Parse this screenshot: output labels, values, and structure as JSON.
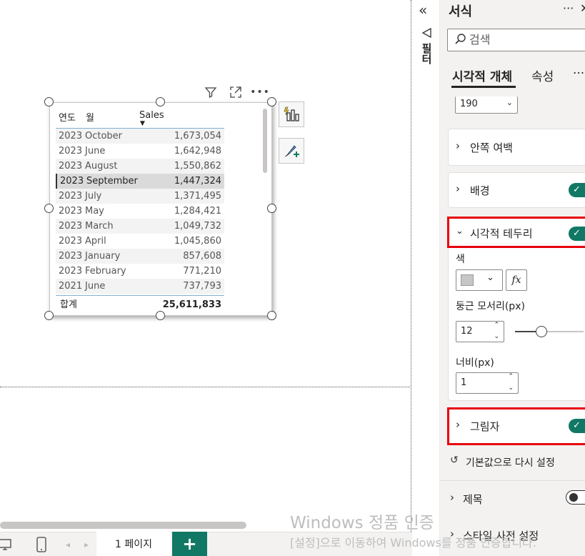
{
  "table": {
    "columns": [
      "연도",
      "월",
      "Sales"
    ],
    "rows": [
      {
        "year": "2023",
        "month": "October",
        "sales": "1,673,054"
      },
      {
        "year": "2023",
        "month": "June",
        "sales": "1,642,948"
      },
      {
        "year": "2023",
        "month": "August",
        "sales": "1,550,862"
      },
      {
        "year": "2023",
        "month": "September",
        "sales": "1,447,324"
      },
      {
        "year": "2023",
        "month": "July",
        "sales": "1,371,495"
      },
      {
        "year": "2023",
        "month": "May",
        "sales": "1,284,421"
      },
      {
        "year": "2023",
        "month": "March",
        "sales": "1,049,732"
      },
      {
        "year": "2023",
        "month": "April",
        "sales": "1,045,860"
      },
      {
        "year": "2023",
        "month": "January",
        "sales": "857,608"
      },
      {
        "year": "2023",
        "month": "February",
        "sales": "771,210"
      },
      {
        "year": "2021",
        "month": "June",
        "sales": "737,793"
      }
    ],
    "total_label": "합계",
    "total_value": "25,611,833",
    "sort_icon": "sort-descending-icon"
  },
  "visual_toolbar": [
    "filter-icon",
    "focus-mode-icon",
    "more-options-icon"
  ],
  "side_buttons": [
    "quick-insights-icon",
    "format-brush-icon"
  ],
  "filter_strip": {
    "label": "필터"
  },
  "pane": {
    "title": "서식",
    "more": "···",
    "close": "✕",
    "search_placeholder": "검색",
    "tabs": [
      "시각적 개체",
      "속성"
    ],
    "tabs_more": "···",
    "partial_value": "190",
    "sections": {
      "padding": "안쪽 여백",
      "background": "배경",
      "border": "시각적 테두리",
      "shadow": "그림자",
      "title": "제목",
      "style": "스타일 사전 설정"
    },
    "border_settings": {
      "color_label": "색",
      "radius_label": "둥근 모서리(px)",
      "radius_value": "12",
      "width_label": "너비(px)",
      "width_value": "1"
    },
    "reset": "기본값으로 다시 설정"
  },
  "bottom": {
    "page_tab": "1 페이지",
    "add": "+"
  },
  "watermark": {
    "line1": "Windows 정품 인증",
    "line2": "[설정]으로 이동하여 Windows를 정품 인증합니다."
  },
  "colors": {
    "accent": "#117865",
    "highlight": "#e8000b"
  }
}
